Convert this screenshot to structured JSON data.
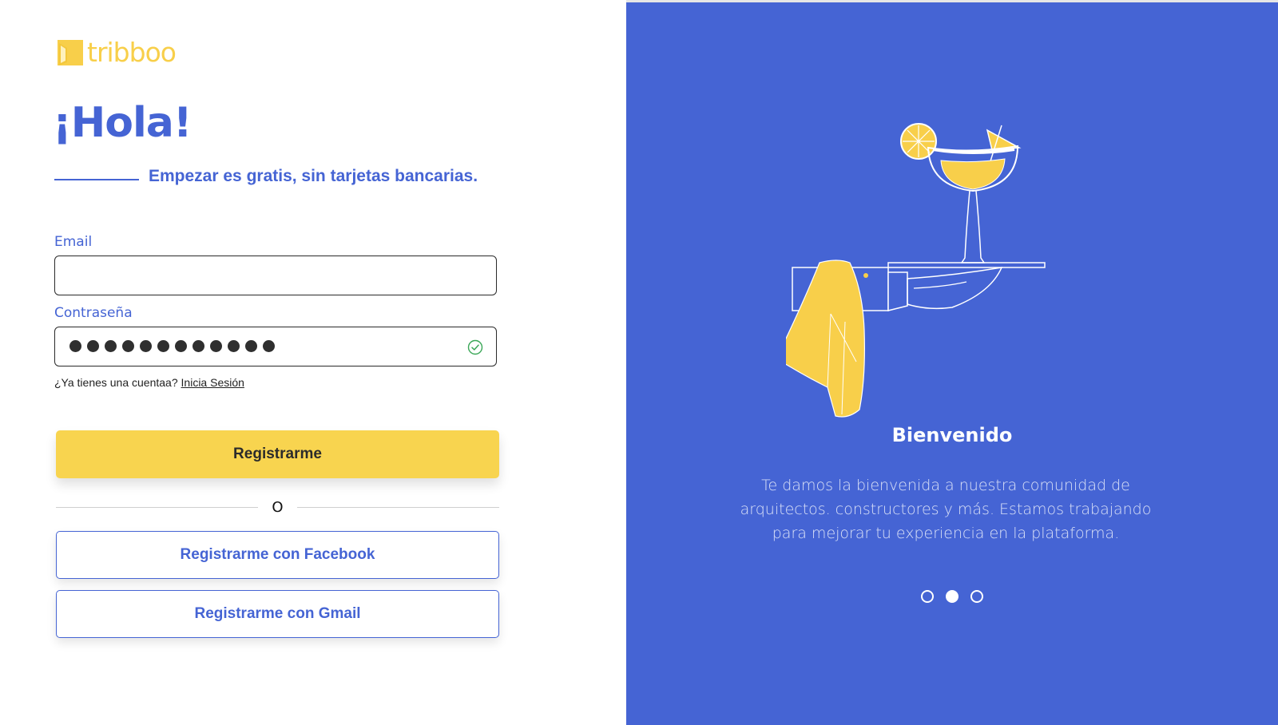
{
  "brand": {
    "name": "tribboo",
    "color": "#f8cf4a",
    "accent": "#4564d4"
  },
  "left": {
    "greeting": "¡Hola!",
    "subtitle": "Empezar es gratis, sin tarjetas bancarias.",
    "email_label": "Email",
    "email_value": "",
    "password_label": "Contraseña",
    "password_mask_count": 12,
    "account_prompt": "¿Ya tienes una cuentaa?",
    "login_link": "Inicia Sesión",
    "register_button": "Registrarme",
    "divider_text": "O",
    "facebook_button": "Registrarme con Facebook",
    "gmail_button": "Registrarme con Gmail"
  },
  "right": {
    "title": "Bienvenido",
    "text": "Te damos la bienvenida a nuestra comunidad de arquitectos. constructores y más. Estamos trabajando para mejorar tu experiencia en la plataforma.",
    "pager": {
      "count": 3,
      "active_index": 1
    },
    "background": "#4564d4",
    "illustration": "waiter-hand-cocktail-tray"
  }
}
